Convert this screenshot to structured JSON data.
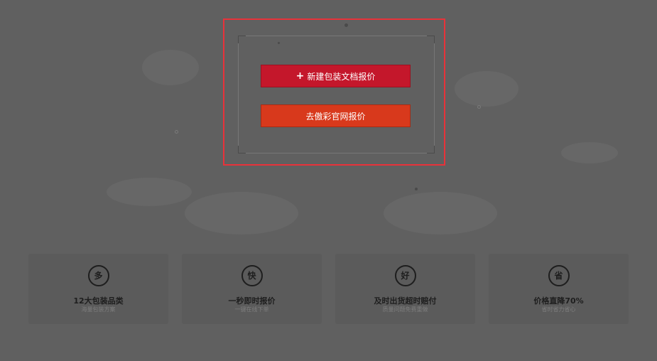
{
  "actions": {
    "new_doc_quote": "新建包装文档报价",
    "new_doc_plus": "+",
    "official_site_quote": "去傲彩官网报价"
  },
  "features": [
    {
      "icon_char": "多",
      "icon_name": "more-icon",
      "title": "12大包装品类",
      "subtitle": "海量包装方案"
    },
    {
      "icon_char": "快",
      "icon_name": "fast-icon",
      "title": "一秒即时报价",
      "subtitle": "一键在线下单"
    },
    {
      "icon_char": "好",
      "icon_name": "good-icon",
      "title": "及时出货超时赔付",
      "subtitle": "质量问题免费重做"
    },
    {
      "icon_char": "省",
      "icon_name": "save-icon",
      "title": "价格直降70%",
      "subtitle": "省时省力省心"
    }
  ],
  "colors": {
    "primary_button": "#c4172b",
    "secondary_button": "#d8391c",
    "highlight_border": "#e8323a"
  }
}
